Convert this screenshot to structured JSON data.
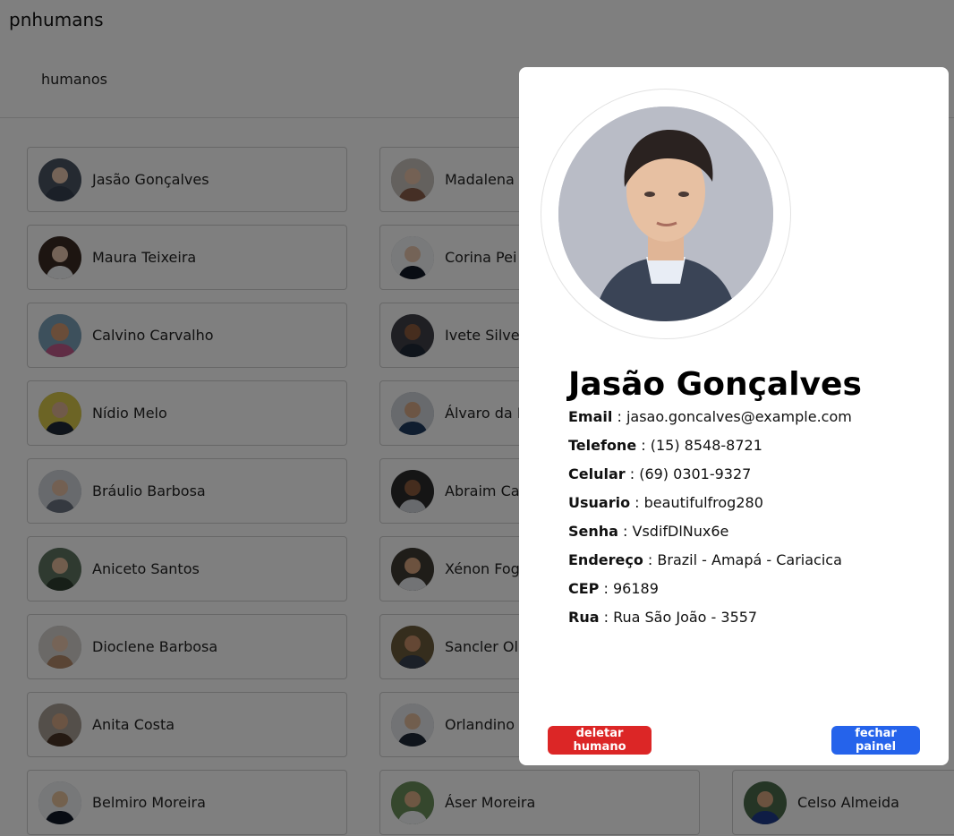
{
  "app": {
    "title": "pnhumans"
  },
  "nav": {
    "link_label": "humanos"
  },
  "people": [
    {
      "name": "Jasão Gonçalves",
      "avatar_color": "#4b5563"
    },
    {
      "name": "Madalena",
      "avatar_color": "#8b5e4a"
    },
    {
      "name": "Maura Teixeira",
      "avatar_color": "#3b2a22"
    },
    {
      "name": "Corina Pei",
      "avatar_color": "#c9b39c"
    },
    {
      "name": "Calvino Carvalho",
      "avatar_color": "#a8653f"
    },
    {
      "name": "Ivete Silvei",
      "avatar_color": "#5a3a2a"
    },
    {
      "name": "Nídio Melo",
      "avatar_color": "#c9b53a"
    },
    {
      "name": "Álvaro da F",
      "avatar_color": "#6b7280"
    },
    {
      "name": "Bráulio Barbosa",
      "avatar_color": "#9ca3af"
    },
    {
      "name": "Abraim Ca",
      "avatar_color": "#2b2b2b"
    },
    {
      "name": "Aniceto Santos",
      "avatar_color": "#5f7560"
    },
    {
      "name": "Xénon Fog",
      "avatar_color": "#3f3a33"
    },
    {
      "name": "Dioclene Barbosa",
      "avatar_color": "#b58a6a"
    },
    {
      "name": "Sancler Oli",
      "avatar_color": "#6b5a3a"
    },
    {
      "name": "Anita Costa",
      "avatar_color": "#4a3426"
    },
    {
      "name": "Orlandino",
      "avatar_color": "#7b8794"
    },
    {
      "name": "Belmiro Moreira",
      "avatar_color": "#e5e7eb"
    },
    {
      "name": "Áser Moreira",
      "avatar_color": "#6b8f5b"
    },
    {
      "name": "Celso Almeida",
      "avatar_color": "#4b6b4b"
    }
  ],
  "detail": {
    "name": "Jasão Gonçalves",
    "fields": [
      {
        "label": "Email",
        "value": " : jasao.goncalves@example.com"
      },
      {
        "label": "Telefone",
        "value": " : (15) 8548-8721"
      },
      {
        "label": "Celular",
        "value": " : (69) 0301-9327"
      },
      {
        "label": "Usuario",
        "value": " : beautifulfrog280"
      },
      {
        "label": "Senha",
        "value": " : VsdifDlNux6e"
      },
      {
        "label": "Endereço",
        "value": " : Brazil - Amapá - Cariacica"
      },
      {
        "label": "CEP",
        "value": " : 96189"
      },
      {
        "label": "Rua",
        "value": " : Rua São João - 3557"
      }
    ],
    "delete_button": "deletar humano",
    "close_button": "fechar painel"
  },
  "colors": {
    "danger": "#dc2626",
    "primary": "#2563eb",
    "overlay": "rgba(0,0,0,0.5)"
  },
  "icons": {
    "avatar": "person-photo-icon"
  }
}
